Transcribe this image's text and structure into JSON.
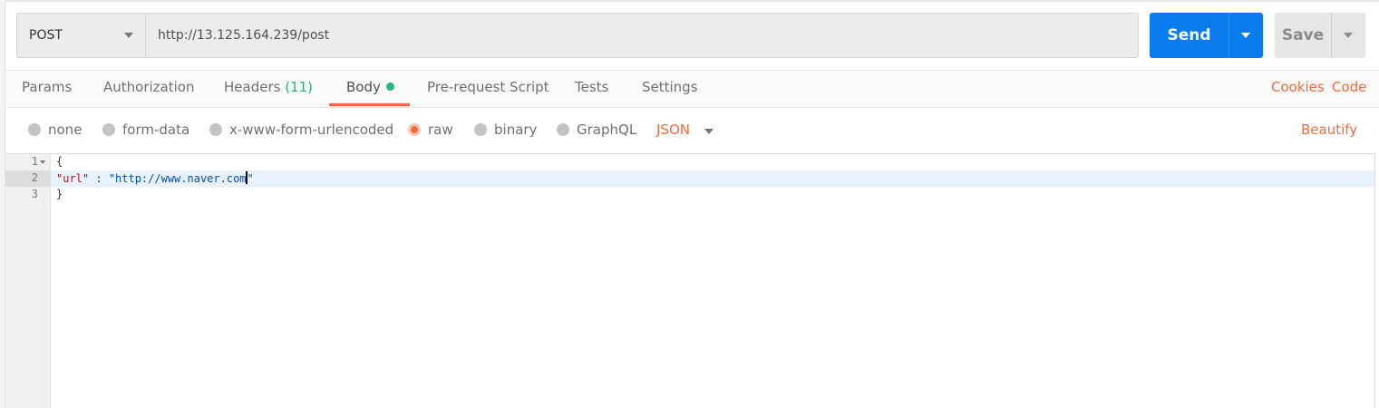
{
  "request": {
    "method": "POST",
    "url": "http://13.125.164.239/post",
    "send_label": "Send",
    "save_label": "Save"
  },
  "tabs": [
    {
      "label": "Params"
    },
    {
      "label": "Authorization"
    },
    {
      "label": "Headers",
      "count": "(11)"
    },
    {
      "label": "Body",
      "active": true
    },
    {
      "label": "Pre-request Script"
    },
    {
      "label": "Tests"
    },
    {
      "label": "Settings"
    }
  ],
  "links": {
    "cookies": "Cookies",
    "code": "Code"
  },
  "body_options": {
    "modes": [
      "none",
      "form-data",
      "x-www-form-urlencoded",
      "raw",
      "binary",
      "GraphQL"
    ],
    "selected": "raw",
    "type": "JSON",
    "beautify": "Beautify"
  },
  "editor": {
    "line_numbers": [
      "1",
      "2",
      "3"
    ],
    "lines": {
      "l1": "{",
      "l2_key": "\"url\"",
      "l2_sep": " : ",
      "l2_value_a": "\"http://www.naver.com",
      "l2_value_b": "\"",
      "l3": "}"
    }
  },
  "colors": {
    "accent": "#f26b3a",
    "send": "#097bed",
    "status_dot": "#26b47f"
  }
}
